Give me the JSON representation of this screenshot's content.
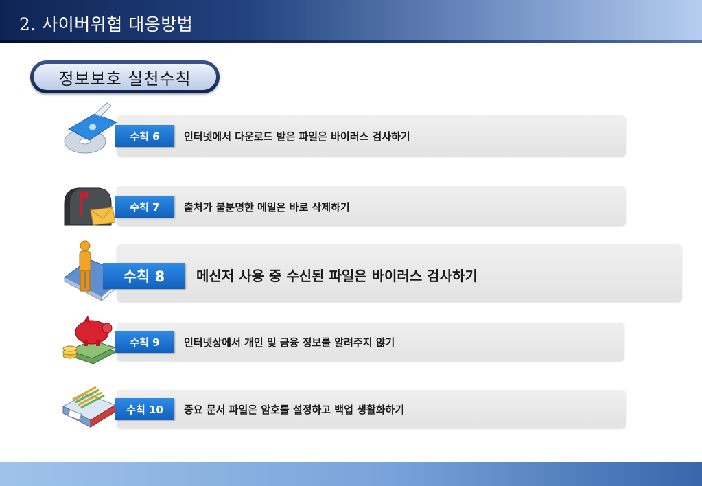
{
  "header": {
    "title": "2. 사이버위협 대응방법"
  },
  "section": {
    "title": "정보보호 실천수칙"
  },
  "rules": [
    {
      "label": "수칙 6",
      "text": "인터넷에서 다운로드 받은 파일은 바이러스 검사하기",
      "icon": "cd-scanner-icon"
    },
    {
      "label": "수칙 7",
      "text": "출처가 불분명한 메일은 바로 삭제하기",
      "icon": "mailbox-icon"
    },
    {
      "label": "수칙 8",
      "text": "메신저 사용 중 수신된 파일은 바이러스 검사하기",
      "icon": "messenger-user-icon"
    },
    {
      "label": "수칙 9",
      "text": "인터넷상에서 개인 및 금융 정보를 알려주지 않기",
      "icon": "piggy-bank-icon"
    },
    {
      "label": "수칙 10",
      "text": "중요 문서 파일은 암호를 설정하고 백업 생활화하기",
      "icon": "save-disk-icon"
    }
  ],
  "colors": {
    "tag": "#1a72d0",
    "header_dark": "#0e2454",
    "footer_right": "#3a65ab"
  }
}
